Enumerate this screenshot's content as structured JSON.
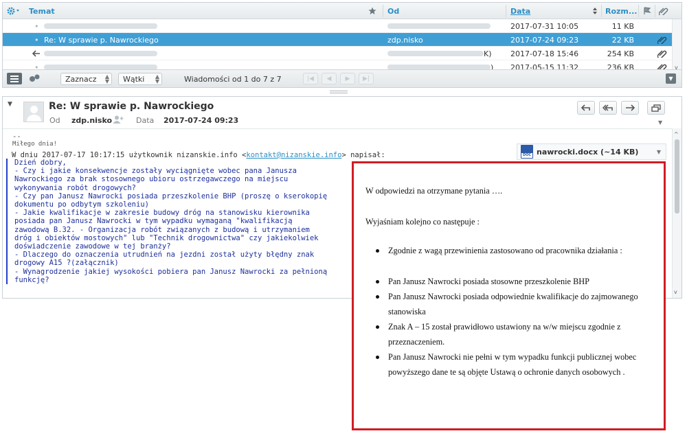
{
  "list": {
    "columns": {
      "subject": "Temat",
      "from": "Od",
      "date": "Data",
      "size": "Rozm..."
    },
    "rows": [
      {
        "subject": "",
        "from": "",
        "date": "2017-07-31 10:05",
        "size": "11 KB",
        "selected": false,
        "from_suffix": "",
        "attachment": false
      },
      {
        "subject": "Re: W sprawie p. Nawrockiego",
        "from": "zdp.nisko",
        "date": "2017-07-24 09:23",
        "size": "22 KB",
        "selected": true,
        "from_suffix": "",
        "attachment": true
      },
      {
        "subject": "",
        "from": "",
        "date": "2017-07-18 15:46",
        "size": "254 KB",
        "selected": false,
        "from_suffix": "K)",
        "attachment": true
      },
      {
        "subject": "",
        "from": "",
        "date": "2017-05-15 11:32",
        "size": "236 KB",
        "selected": false,
        "from_suffix": ")",
        "attachment": true
      }
    ],
    "toolbar": {
      "select_label": "Zaznacz",
      "threads_label": "Wątki",
      "count_text": "Wiadomości od 1 do 7 z 7"
    }
  },
  "preview": {
    "subject": "Re: W sprawie p. Nawrockiego",
    "from_label": "Od",
    "from_value": "zdp.nisko",
    "date_label": "Data",
    "date_value": "2017-07-24 09:23",
    "attachment_name": "nawrocki.docx (~14 KB)",
    "attachment_icon_text": "DOC",
    "body": {
      "sig_sep": "--",
      "sig": "Miłego dnia!",
      "intro_prefix": "W dniu 2017-07-17 10:17:15 użytkownik nizanskie.info <",
      "intro_email": "kontakt@nizanskie.info",
      "intro_suffix": "> napisał:",
      "quote_lines": [
        "Dzień dobry,",
        "- Czy i jakie konsekwencje zostały wyciągnięte wobec pana Janusza",
        "Nawrockiego za brak stosownego ubioru ostrzegawczego na miejscu",
        "wykonywania robót drogowych?",
        "- Czy pan Janusz Nawrocki posiada przeszkolenie BHP (proszę o kserokopię",
        "dokumentu po odbytym szkoleniu)",
        "- Jakie kwalifikacje w zakresie budowy dróg na stanowisku kierownika",
        "posiada pan Janusz Nawrocki w tym wypadku wymaganą \"kwalifikacją",
        "zawodową B.32. - Organizacja robót związanych z budową i utrzymaniem",
        "dróg i obiektów mostowych\" lub \"Technik drogownictwa\" czy jakiekolwiek",
        "doświadczenie zawodowe w tej branży?",
        "- Dlaczego do oznaczenia utrudnień na jezdni został użyty błędny znak",
        "drogowy A15 ?(załącznik)",
        "- Wynagrodzenie jakiej wysokości pobiera pan Janusz Nawrocki za pełnioną",
        "funkcję?"
      ]
    }
  },
  "document": {
    "line1": "W odpowiedzi na otrzymane pytania ….",
    "line2": "Wyjaśniam kolejno co następuje :",
    "bullet_first": "Zgodnie z wagą przewinienia zastosowano od pracownika działania :",
    "bullets": [
      "Pan Janusz Nawrocki posiada stosowne przeszkolenie BHP",
      "Pan Janusz Nawrocki posiada odpowiednie kwalifikacje do zajmowanego stanowiska",
      "Znak A – 15 został prawidłowo ustawiony na w/w miejscu zgodnie z przeznaczeniem.",
      "Pan Janusz Nawrocki nie pełni w tym wypadku funkcji publicznej wobec powyższego dane te są objęte Ustawą o ochronie danych osobowych ."
    ]
  },
  "colors": {
    "accent": "#2a8fc5",
    "selected_row": "#3f9fd5",
    "quote": "#1c2f9c",
    "frame": "#d11c23"
  }
}
